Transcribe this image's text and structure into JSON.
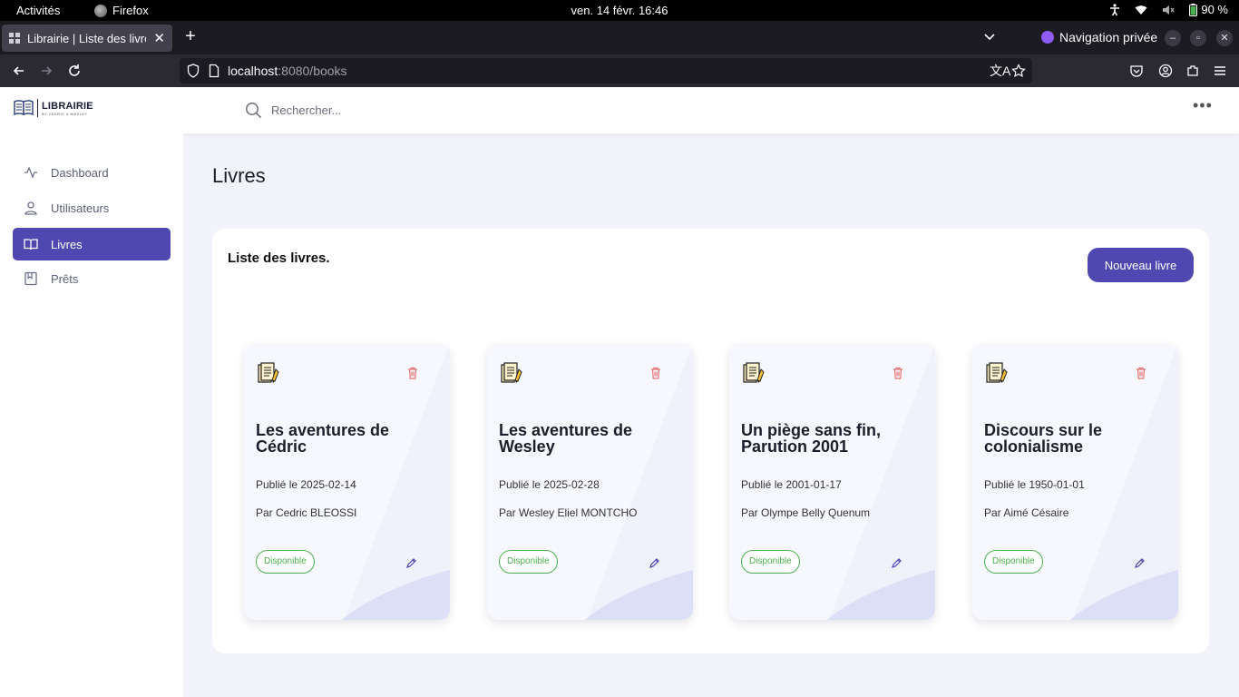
{
  "system": {
    "activities": "Activités",
    "app_name": "Firefox",
    "clock": "ven. 14 févr.  16:46",
    "battery": "90 %"
  },
  "browser": {
    "tab_title": "Librairie | Liste des livres",
    "private_label": "Navigation privée",
    "url_host": "localhost",
    "url_path": ":8080/books"
  },
  "header": {
    "brand": "LIBRAIRIE",
    "brand_sub": "BY CEDRIC & WESLEY",
    "search_placeholder": "Rechercher..."
  },
  "sidebar": {
    "items": [
      {
        "label": "Dashboard",
        "icon": "activity-icon",
        "active": false
      },
      {
        "label": "Utilisateurs",
        "icon": "user-icon",
        "active": false
      },
      {
        "label": "Livres",
        "icon": "book-open-icon",
        "active": true
      },
      {
        "label": "Prêts",
        "icon": "bookmark-book-icon",
        "active": false
      }
    ]
  },
  "main": {
    "page_title": "Livres",
    "panel_title": "Liste des livres.",
    "new_book_label": "Nouveau livre",
    "books": [
      {
        "title": "Les aventures de Cédric",
        "published": "Publié le 2025-02-14",
        "author": "Par Cedric BLEOSSI",
        "status": "Disponible"
      },
      {
        "title": "Les aventures de Wesley",
        "published": "Publié le 2025-02-28",
        "author": "Par Wesley Eliel MONTCHO",
        "status": "Disponible"
      },
      {
        "title": "Un piège sans fin, Parution 2001",
        "published": "Publié le 2001-01-17",
        "author": "Par Olympe Belly Quenum",
        "status": "Disponible"
      },
      {
        "title": "Discours sur le colonialisme",
        "published": "Publié le 1950-01-01",
        "author": "Par Aimé Césaire",
        "status": "Disponible"
      }
    ]
  },
  "colors": {
    "accent": "#4e48b0",
    "status_green": "#4caf50",
    "danger": "#e57373"
  }
}
